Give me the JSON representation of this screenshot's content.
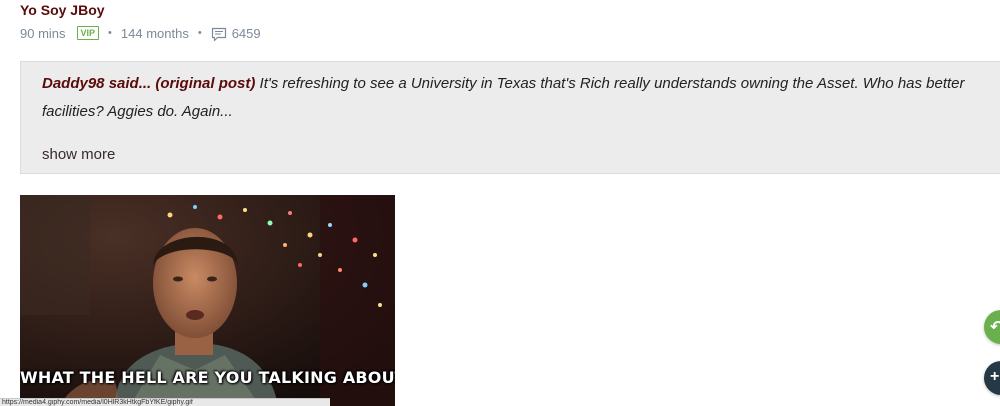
{
  "post": {
    "author": "Yo Soy JBoy",
    "posted_ago": "90 mins",
    "badge": "VIP",
    "member_for": "144 months",
    "separator": "•",
    "reply_count": "6459"
  },
  "quote": {
    "author_said": "Daddy98 said...",
    "original_post_label": "(original post)",
    "body": " It's refreshing to see a University in Texas that's Rich really understands owning the Asset. Who has better facilities? Aggies do. Again...",
    "show_more": "show more"
  },
  "media": {
    "caption": "WHAT THE HELL ARE YOU TALKING ABOUT?"
  },
  "status_bar": {
    "url": "https://media4.giphy.com/media/l0HlR3kHtkgFbYfKE/giphy.gif"
  },
  "colors": {
    "author": "#5a0b0b",
    "meta_text": "#7a8a9a",
    "vip_green": "#6ab04c",
    "quote_bg": "#ececec",
    "fab_green": "#6ab04c",
    "fab_navy": "#253845"
  },
  "icons": {
    "reply": "speech-bubble-icon",
    "fab_top": "reply-arrow-icon",
    "fab_bottom": "plus-icon"
  }
}
